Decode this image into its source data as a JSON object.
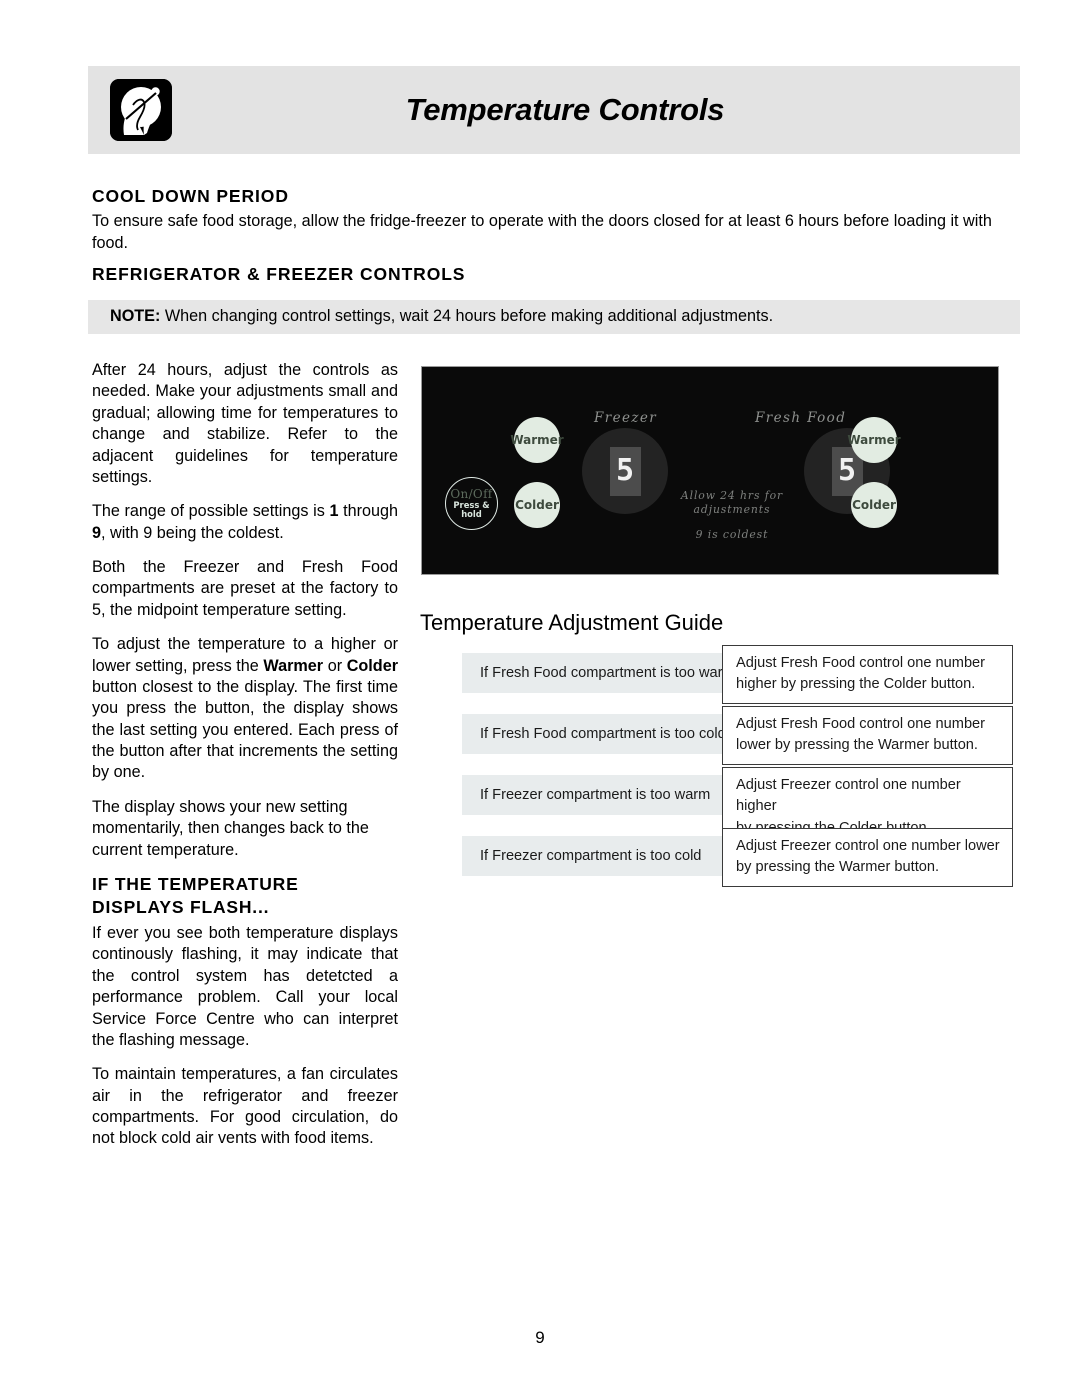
{
  "header": {
    "title": "Temperature Controls",
    "icon": "hand-dial-icon"
  },
  "sections": {
    "cool_down": {
      "heading": "COOL DOWN PERIOD",
      "body": "To ensure safe food storage, allow the fridge-freezer to operate with the doors closed for at least 6 hours before loading it with food."
    },
    "controls": {
      "heading": "REFRIGERATOR & FREEZER CONTROLS",
      "note_label": "NOTE:",
      "note_text": "When changing control settings, wait 24 hours before making additional adjustments."
    },
    "flash": {
      "heading_line1": "IF THE TEMPERATURE",
      "heading_line2": "DISPLAYS FLASH...",
      "paragraphs": [
        "If ever you see both temperature displays continously flashing, it may indicate that the control system has detetcted a performance problem. Call your local Service Force Centre  who can interpret the flashing message.",
        "To maintain temperatures, a fan circulates air in the refrigerator and freezer compartments. For good circulation, do not block cold air vents with food items."
      ]
    }
  },
  "left_column": {
    "p1": "After 24 hours, adjust the controls as needed. Make your adjustments small and gradual; allowing time for temperatures to change and stabilize. Refer to the adjacent guidelines for temperature settings.",
    "p2_a": "The range of possible settings is ",
    "p2_b": "1",
    "p2_c": " through ",
    "p2_d": "9",
    "p2_e": ", with 9 being the coldest.",
    "p3": "Both the Freezer and Fresh Food compartments are preset at the factory to 5, the midpoint temperature setting.",
    "p4_a": "To adjust the temperature to a higher or lower setting, press the ",
    "p4_b": "Warmer",
    "p4_c": " or ",
    "p4_d": "Colder",
    "p4_e": " button closest to the display. The first time you press the button, the display shows the last setting you entered. Each press of the button after that increments the setting by one.",
    "p5": "The display shows your new setting momentarily, then changes back to the current temperature."
  },
  "control_panel": {
    "freezer_label": "Freezer",
    "fresh_food_label": "Fresh Food",
    "freezer_value": "5",
    "fresh_food_value": "5",
    "warmer_label": "Warmer",
    "colder_label": "Colder",
    "onoff_label": "On/Off",
    "onoff_sub_line1": "Press &",
    "onoff_sub_line2": "hold",
    "note_line1": "Allow 24 hrs for",
    "note_line2": "adjustments",
    "note_line3": "9 is coldest",
    "panel_color": "#0a0a0a",
    "button_color": "#e2ece2"
  },
  "guide": {
    "title": "Temperature Adjustment Guide",
    "rows": [
      {
        "condition": "If Fresh Food compartment is too warm",
        "action_line1": "Adjust Fresh Food control one number",
        "action_line2": "higher by pressing the Colder  button."
      },
      {
        "condition": "If Fresh Food compartment is too cold",
        "action_line1": "Adjust Fresh Food control one number",
        "action_line2": "lower by pressing the Warmer  button."
      },
      {
        "condition": "If Freezer compartment is too warm",
        "action_line1": "Adjust Freezer control one number higher",
        "action_line2": "by pressing the Colder  button."
      },
      {
        "condition": "If Freezer compartment is too cold",
        "action_line1": "Adjust Freezer control one number lower",
        "action_line2": "by pressing the Warmer  button."
      }
    ]
  },
  "page_number": "9"
}
